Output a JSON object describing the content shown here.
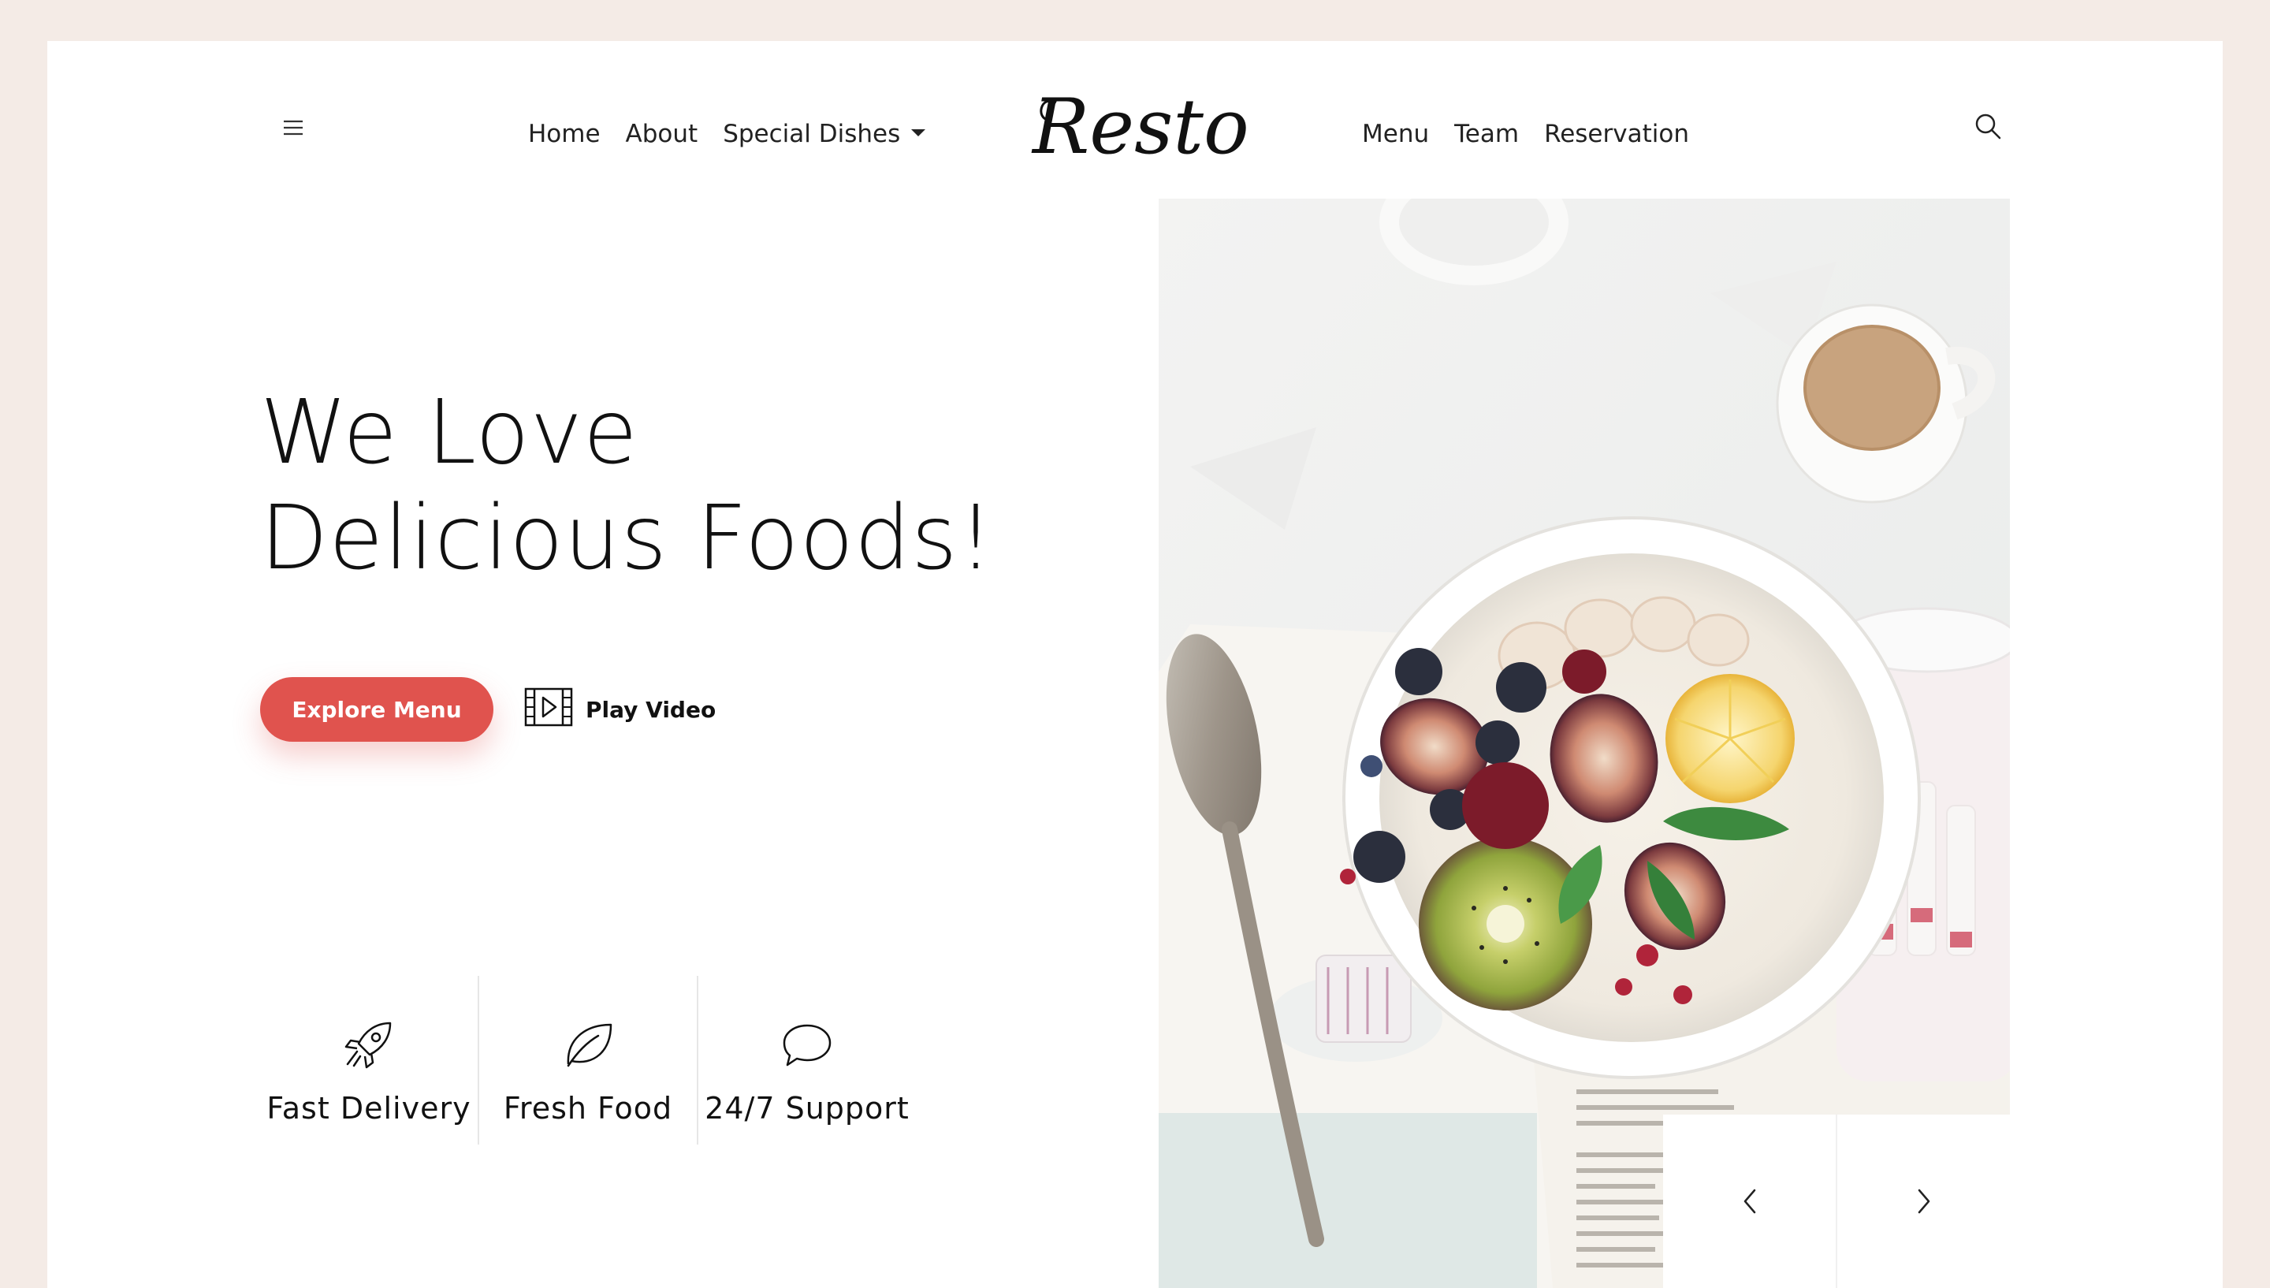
{
  "brand": {
    "logo_text": "Resto"
  },
  "nav": {
    "left": [
      {
        "label": "Home"
      },
      {
        "label": "About"
      },
      {
        "label": "Special Dishes",
        "has_dropdown": true
      }
    ],
    "right": [
      {
        "label": "Menu"
      },
      {
        "label": "Team"
      },
      {
        "label": "Reservation"
      }
    ]
  },
  "icons": {
    "menu": "hamburger-icon",
    "search": "search-icon",
    "video": "film-play-icon",
    "prev": "chevron-left-icon",
    "next": "chevron-right-icon"
  },
  "hero": {
    "title_line1": "We Love",
    "title_line2": "Delicious Foods!",
    "primary_button": "Explore Menu",
    "secondary_button": "Play Video"
  },
  "features": [
    {
      "label": "Fast Delivery",
      "icon": "rocket-icon"
    },
    {
      "label": "Fresh Food",
      "icon": "leaf-icon"
    },
    {
      "label": "24/7 Support",
      "icon": "chat-bubble-icon"
    }
  ],
  "colors": {
    "page_bg": "#f4ebe6",
    "accent": "#e0534e",
    "text": "#111111"
  }
}
